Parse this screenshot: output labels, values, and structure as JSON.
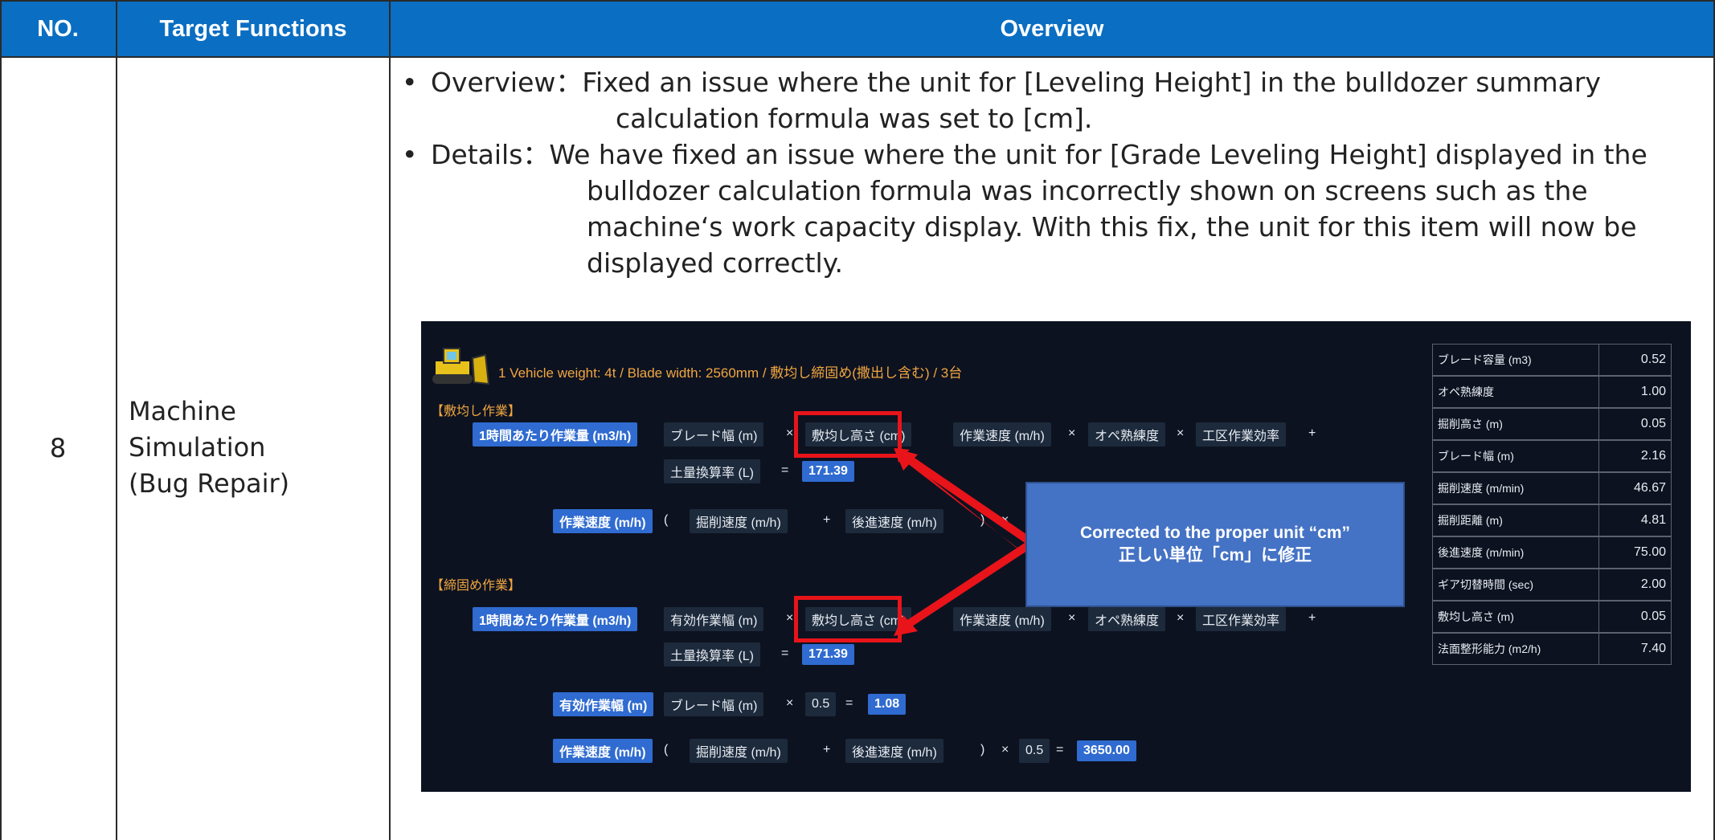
{
  "table": {
    "headers": {
      "no": "NO.",
      "target": "Target Functions",
      "overview": "Overview"
    },
    "row": {
      "no": "8",
      "target_lines": [
        "Machine",
        "Simulation",
        "(Bug Repair)"
      ],
      "overview": {
        "line1": "Overview：Fixed an issue where the unit for [Leveling Height] in the bulldozer summary",
        "line2": "calculation formula was set to [cm].",
        "line3": "Details：We have fixed an issue where the unit for [Grade Leveling Height] displayed in the",
        "line4": "bulldozer calculation formula was incorrectly shown on screens such as the",
        "line5": "machine‘s work capacity display. With this fix, the unit for this item will now be",
        "line6": "displayed correctly.",
        "bullet": "•"
      }
    }
  },
  "screenshot": {
    "title": "1   Vehicle weight: 4t / Blade width: 2560mm   /   敷均し締固め(撒出し含む)   /   3台",
    "section1": "【敷均し作業】",
    "section2": "【締固め作業】",
    "chips": {
      "per_hour": "1時間あたり作業量 (m3/h)",
      "blade_width": "ブレード幅 (m)",
      "leveling_height": "敷均し高さ (cm)",
      "work_speed": "作業速度 (m/h)",
      "ope_skill": "オペ熟練度",
      "zone_eff": "工区作業効率",
      "soil_rate": "土量換算率 (L)",
      "soil_val": "171.39",
      "work_speed_label": "作業速度 (m/h)",
      "dig_speed": "掘削速度  (m/h)",
      "back_speed": "後進速度  (m/h)",
      "eff_width": "有効作業幅 (m)",
      "eff_width_label": "有効作業幅 (m)",
      "half": "0.5",
      "eff_val": "1.08",
      "speed_val": "3650.00"
    },
    "ops": {
      "times": "×",
      "plus": "+",
      "eq": "=",
      "close": ")",
      "open": "("
    },
    "callout": {
      "line1": "Corrected to the proper unit “cm”",
      "line2": "正しい単位「cm」に修正"
    },
    "params": [
      {
        "label": "ブレード容量 (m3)",
        "value": "0.52"
      },
      {
        "label": "オペ熟練度",
        "value": "1.00"
      },
      {
        "label": "掘削高さ (m)",
        "value": "0.05"
      },
      {
        "label": "ブレード幅 (m)",
        "value": "2.16"
      },
      {
        "label": "掘削速度 (m/min)",
        "value": "46.67"
      },
      {
        "label": "掘削距離 (m)",
        "value": "4.81"
      },
      {
        "label": "後進速度 (m/min)",
        "value": "75.00"
      },
      {
        "label": "ギア切替時間 (sec)",
        "value": "2.00"
      },
      {
        "label": "敷均し高さ (m)",
        "value": "0.05"
      },
      {
        "label": "法面整形能力 (m2/h)",
        "value": "7.40"
      }
    ],
    "icons": {
      "dozer": "bulldozer-icon"
    }
  }
}
